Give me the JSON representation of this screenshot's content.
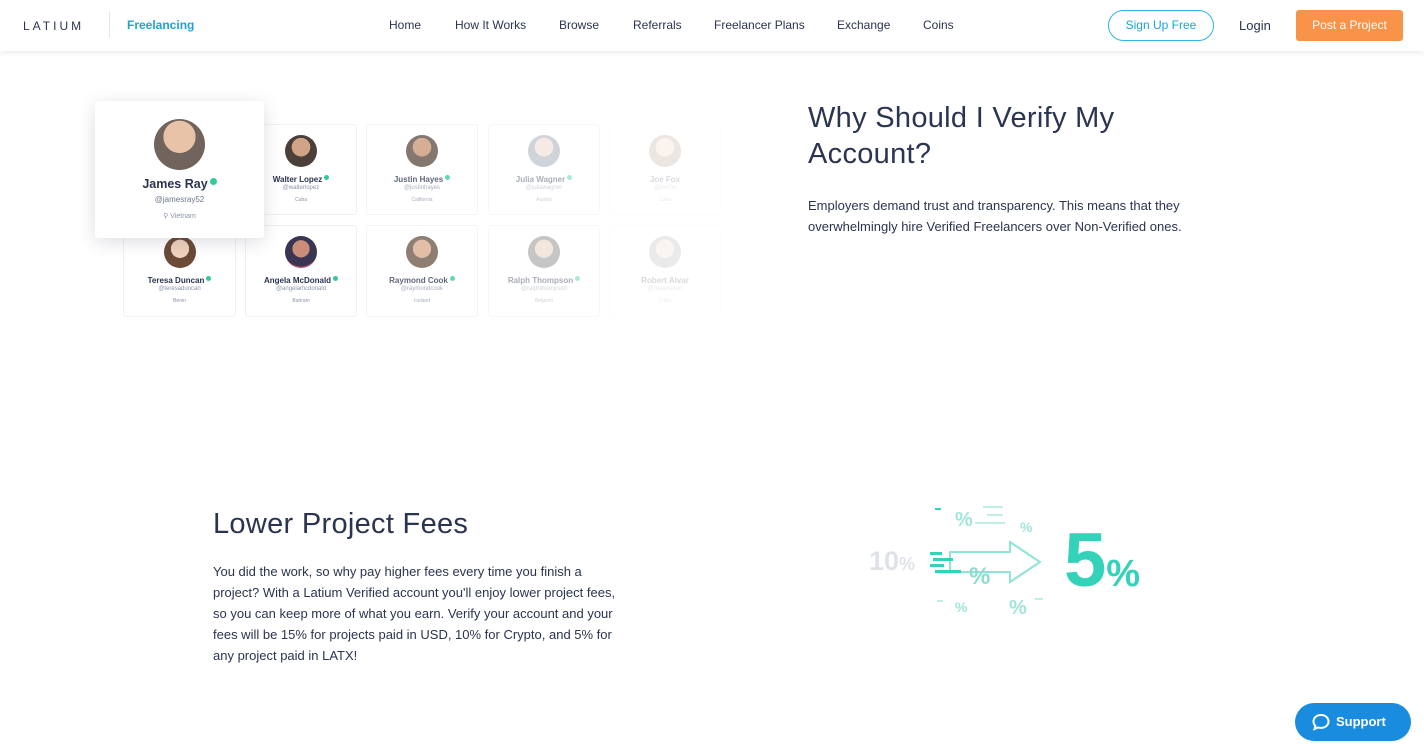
{
  "header": {
    "logo": "LATIUM",
    "product": "Freelancing",
    "nav": [
      "Home",
      "How It Works",
      "Browse",
      "Referrals",
      "Freelancer Plans",
      "Exchange",
      "Coins"
    ],
    "signup_label": "Sign Up Free",
    "login_label": "Login",
    "post_label": "Post a Project"
  },
  "profiles": {
    "featured": {
      "name": "James Ray",
      "handle": "@jamesray52",
      "location": "Vietnam",
      "verified": true
    },
    "cards": [
      {
        "name": "Walter Lopez",
        "handle": "@walterlopez",
        "location": "Cuba"
      },
      {
        "name": "Justin Hayes",
        "handle": "@justinhayes",
        "location": "California"
      },
      {
        "name": "Julia Wagner",
        "handle": "@juliawagner",
        "location": "Austria"
      },
      {
        "name": "Joe Fox",
        "handle": "@joefox",
        "location": "Cuba"
      },
      {
        "name": "Teresa Duncan",
        "handle": "@teresaduncan",
        "location": "Benin"
      },
      {
        "name": "Angela McDonald",
        "handle": "@angelamcdonald",
        "location": "Bahrain"
      },
      {
        "name": "Raymond Cook",
        "handle": "@raymondcook",
        "location": "Iceland"
      },
      {
        "name": "Ralph Thompson",
        "handle": "@ralphthompson",
        "location": "Belgium"
      },
      {
        "name": "Robert Alvar",
        "handle": "@robertalvar",
        "location": "Cuba"
      }
    ]
  },
  "verify": {
    "title": "Why Should I Verify My Account?",
    "body": "Employers demand trust and transparency. This means that they overwhelmingly hire Verified Freelancers over Non-Verified ones."
  },
  "fees": {
    "title": "Lower Project Fees",
    "body": "You did the work, so why pay higher fees every time you finish a project? With a Latium Verified account you'll enjoy lower project fees, so you can keep more of what you earn. Verify your account and your fees will be 15% for projects paid in USD, 10% for Crypto, and 5% for any project paid in LATX!",
    "from_value": "10",
    "to_value": "5",
    "percent": "%"
  },
  "support": {
    "label": "Support",
    "icon": "chat-bubble-icon"
  },
  "colors": {
    "accent": "#1aa3d6",
    "cta": "#f9934a",
    "teal": "#34d3b9",
    "support": "#1a8cdf",
    "text": "#2b3450"
  }
}
